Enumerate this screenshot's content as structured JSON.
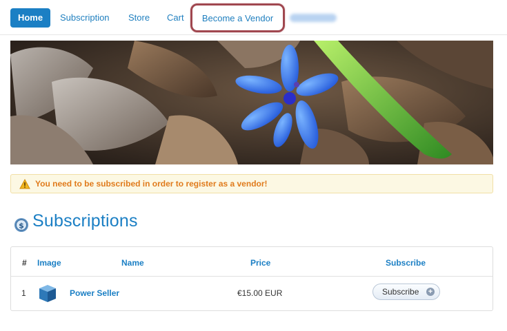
{
  "nav": {
    "items": [
      {
        "label": "Home"
      },
      {
        "label": "Subscription"
      },
      {
        "label": "Store"
      },
      {
        "label": "Cart"
      },
      {
        "label": "Become a Vendor"
      }
    ]
  },
  "banner": {
    "icon": "flower-photo"
  },
  "alert": {
    "icon": "warning-icon",
    "text": "You need to be subscribed in order to register as a vendor!"
  },
  "section": {
    "icon": "dollar-badge-icon",
    "title": "Subscriptions"
  },
  "table": {
    "headers": [
      "#",
      "Image",
      "Name",
      "Price",
      "Subscribe"
    ],
    "rows": [
      {
        "num": "1",
        "image_icon": "product-box-icon",
        "name": "Power Seller",
        "price": "€15.00 EUR",
        "button": "Subscribe"
      }
    ]
  },
  "colors": {
    "accent": "#1b7fc4",
    "vendor_highlight": "#a0474f",
    "alert_bg": "#fcf8e3",
    "alert_text": "#e07b1c"
  }
}
